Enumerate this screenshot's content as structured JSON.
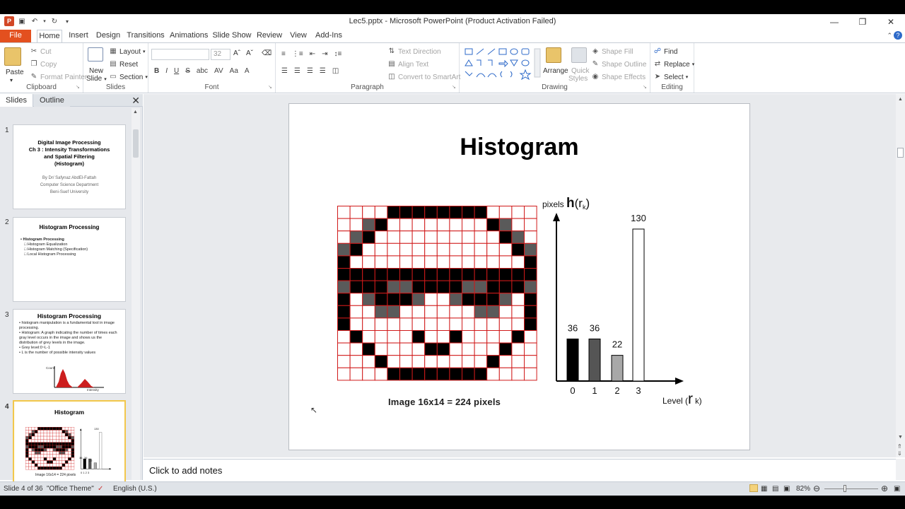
{
  "window": {
    "title": "Lec5.pptx  -  Microsoft PowerPoint (Product Activation Failed)"
  },
  "ribbon_tabs": [
    "File",
    "Home",
    "Insert",
    "Design",
    "Transitions",
    "Animations",
    "Slide Show",
    "Review",
    "View",
    "Add-Ins"
  ],
  "ribbon": {
    "clipboard": {
      "label": "Clipboard",
      "paste": "Paste",
      "cut": "Cut",
      "copy": "Copy",
      "format_painter": "Format Painter"
    },
    "slides": {
      "label": "Slides",
      "new_slide_1": "New",
      "new_slide_2": "Slide",
      "layout": "Layout",
      "reset": "Reset",
      "section": "Section"
    },
    "font": {
      "label": "Font",
      "size": "32"
    },
    "paragraph": {
      "label": "Paragraph",
      "text_direction": "Text Direction",
      "align_text": "Align Text",
      "convert": "Convert to SmartArt"
    },
    "drawing": {
      "label": "Drawing",
      "arrange": "Arrange",
      "quick_styles_1": "Quick",
      "quick_styles_2": "Styles",
      "shape_fill": "Shape Fill",
      "shape_outline": "Shape Outline",
      "shape_effects": "Shape Effects"
    },
    "editing": {
      "label": "Editing",
      "find": "Find",
      "replace": "Replace",
      "select": "Select"
    }
  },
  "pane": {
    "tab_slides": "Slides",
    "tab_outline": "Outline"
  },
  "thumbnails": {
    "s1": {
      "num": "1",
      "title_lines": [
        "Digital Image Processing",
        "Ch 3 : Intensity Transformations",
        "and Spatial Filtering",
        "(Histogram)"
      ],
      "sub_lines": [
        "By Dr/ Safynaz AbdEl-Fattah",
        "Computer Science Department",
        "Beni-Suef University"
      ]
    },
    "s2": {
      "num": "2",
      "title": "Histogram Processing",
      "bullets": [
        "Histogram Processing",
        "Histogram Equalization",
        "Histogram Matching (Specification)",
        "Local Histogram Processing"
      ]
    },
    "s3": {
      "num": "3",
      "title": "Histogram Processing",
      "bullets": [
        "histogram manipulation  is a fundamental  tool in image processing.",
        "Histogram: A graph  indicating the number of times  each gray level occurs in the image and shows us the distribution of grey levels  in the image.",
        "Grey level:0~L-1",
        "L is the number of possible intensity values"
      ],
      "chart_y": "Count",
      "chart_x": "Intensity"
    },
    "s4": {
      "num": "4",
      "title": "Histogram",
      "caption": "Image 16x14 = 224 pixels",
      "value_130": "130",
      "levels": "0 1 2 3",
      "value_36a": "36",
      "value_36b": "36",
      "value_22": "22"
    }
  },
  "slide": {
    "title": "Histogram",
    "image_caption": "Image 16x14 = 224 pixels",
    "pixel_grid": {
      "width": 16,
      "height": 14,
      "rows": [
        "0000333333330000",
        "0023000000003200",
        "0230000000000320",
        "2300000000000032",
        "3000000000000003",
        "3333333333333333",
        "2333223333223332",
        "3023332002333203",
        "3002200000022003",
        "3000000000000003",
        "0300003003000030",
        "0030000330000300",
        "0003000000003000",
        "0000333333330000"
      ],
      "colors": [
        "#ffffff",
        "#a8a8a8",
        "#5a5a5a",
        "#000000"
      ],
      "grid_line_color": "#d01a1a"
    },
    "chart_data": {
      "type": "bar",
      "categories": [
        "0",
        "1",
        "2",
        "3"
      ],
      "values": [
        36,
        36,
        22,
        130
      ],
      "bar_colors": [
        "#000000",
        "#555555",
        "#a8a8a8",
        "#ffffff"
      ],
      "ylabel_prefix": "pixels",
      "ylabel_main": "h",
      "ylabel_arg": "(r",
      "ylabel_sub": "k",
      "ylabel_close": ")",
      "xlabel_prefix": "Level",
      "xlabel_main": "r",
      "xlabel_sub": "k",
      "xlabel_close": ")",
      "ylim": [
        0,
        130
      ]
    }
  },
  "notes": {
    "placeholder": "Click to add notes"
  },
  "status": {
    "slide": "Slide 4 of 36",
    "theme": "\"Office Theme\"",
    "language": "English (U.S.)",
    "zoom": "82%"
  },
  "colors": {
    "file_tab": "#e3501f",
    "accent": "#f2c74c"
  }
}
